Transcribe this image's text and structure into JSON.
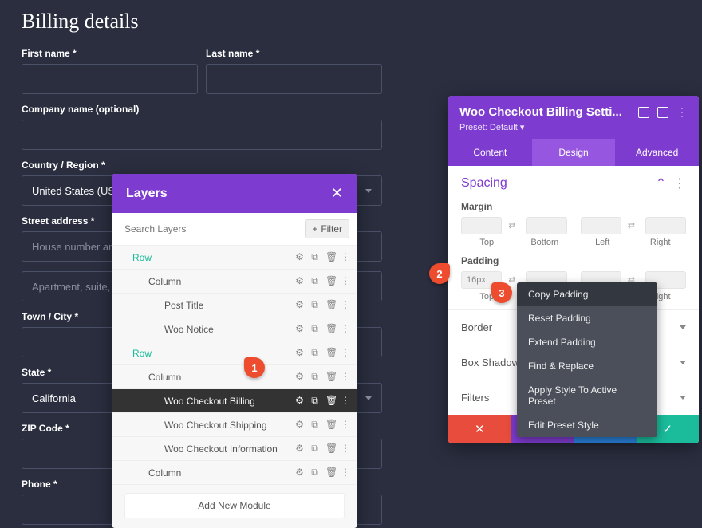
{
  "checkout": {
    "title": "Billing details",
    "firstNameLabel": "First name *",
    "lastNameLabel": "Last name *",
    "companyLabel": "Company name (optional)",
    "countryLabel": "Country / Region *",
    "countryValue": "United States (US)",
    "streetLabel": "Street address *",
    "streetPlaceholder1": "House number and street name",
    "streetPlaceholder2": "Apartment, suite, unit, etc. (optional)",
    "townLabel": "Town / City *",
    "stateLabel": "State *",
    "stateValue": "California",
    "zipLabel": "ZIP Code *",
    "phoneLabel": "Phone *"
  },
  "layers": {
    "title": "Layers",
    "searchPlaceholder": "Search Layers",
    "filterLabel": "Filter",
    "rows": [
      {
        "label": "Row",
        "indent": 1,
        "teal": true
      },
      {
        "label": "Column",
        "indent": 2,
        "teal": false
      },
      {
        "label": "Post Title",
        "indent": 3,
        "teal": false
      },
      {
        "label": "Woo Notice",
        "indent": 3,
        "teal": false
      },
      {
        "label": "Row",
        "indent": 1,
        "teal": true
      },
      {
        "label": "Column",
        "indent": 2,
        "teal": false
      },
      {
        "label": "Woo Checkout Billing",
        "indent": 3,
        "teal": false,
        "active": true
      },
      {
        "label": "Woo Checkout Shipping",
        "indent": 3,
        "teal": false
      },
      {
        "label": "Woo Checkout Information",
        "indent": 3,
        "teal": false
      },
      {
        "label": "Column",
        "indent": 2,
        "teal": false
      }
    ],
    "addNew": "Add New Module"
  },
  "settings": {
    "title": "Woo Checkout Billing Setti...",
    "preset": "Preset: Default",
    "tabs": {
      "content": "Content",
      "design": "Design",
      "advanced": "Advanced"
    },
    "spacing": {
      "title": "Spacing",
      "marginLabel": "Margin",
      "paddingLabel": "Padding",
      "sides": {
        "top": "Top",
        "bottom": "Bottom",
        "left": "Left",
        "right": "Right"
      },
      "paddingTopValue": "16px"
    },
    "accordions": {
      "border": "Border",
      "boxShadow": "Box Shadow",
      "filters": "Filters"
    }
  },
  "contextMenu": {
    "items": [
      "Copy Padding",
      "Reset Padding",
      "Extend Padding",
      "Find & Replace",
      "Apply Style To Active Preset",
      "Edit Preset Style"
    ]
  },
  "markers": {
    "m1": "1",
    "m2": "2",
    "m3": "3"
  }
}
